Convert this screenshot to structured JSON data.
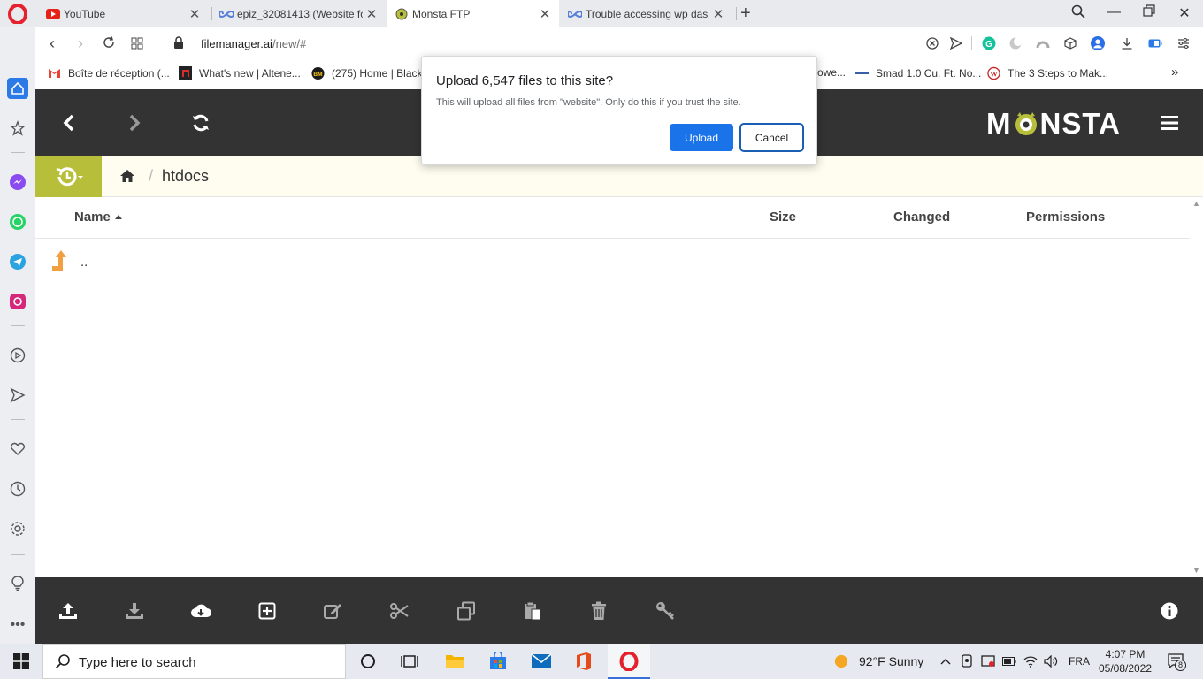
{
  "browser": {
    "tabs": [
      {
        "title": "YouTube",
        "icon": "youtube-icon",
        "active": false
      },
      {
        "title": "epiz_32081413 (Website fo",
        "icon": "infinity-icon",
        "active": false
      },
      {
        "title": "Monsta FTP",
        "icon": "monsta-icon",
        "active": true
      },
      {
        "title": "Trouble accessing wp dash",
        "icon": "infinity-icon",
        "active": false
      }
    ],
    "url_host": "filemanager.ai",
    "url_path": "/new/#",
    "bookmarks": [
      {
        "label": "Boîte de réception (...",
        "icon": "gmail-icon"
      },
      {
        "label": "What's new | Altene...",
        "icon": "altene-icon"
      },
      {
        "label": "(275) Home | Black",
        "icon": "bm-icon"
      },
      {
        "label": "owe...",
        "icon": "generic-icon"
      },
      {
        "label": "Smad 1.0 Cu. Ft. No...",
        "icon": "smad-icon"
      },
      {
        "label": "The 3 Steps to Mak...",
        "icon": "w-icon"
      }
    ]
  },
  "monsta": {
    "brand_prefix": "M",
    "brand_suffix": "NSTA",
    "breadcrumb_current": "htdocs",
    "breadcrumb_sep": "/",
    "columns": {
      "name": "Name",
      "size": "Size",
      "changed": "Changed",
      "permissions": "Permissions"
    },
    "rows": [
      {
        "name": ".."
      }
    ]
  },
  "dialog": {
    "title": "Upload 6,547 files to this site?",
    "message": "This will upload all files from \"website\". Only do this if you trust the site.",
    "upload_label": "Upload",
    "cancel_label": "Cancel"
  },
  "taskbar": {
    "search_placeholder": "Type here to search",
    "weather": "92°F  Sunny",
    "language": "FRA",
    "time": "4:07 PM",
    "date": "05/08/2022",
    "notification_count": "8"
  },
  "colors": {
    "accent_blue": "#1a73e8",
    "monsta_dark": "#333333",
    "monsta_lime": "#b7bf3a",
    "up_arrow_orange": "#f0a040"
  }
}
